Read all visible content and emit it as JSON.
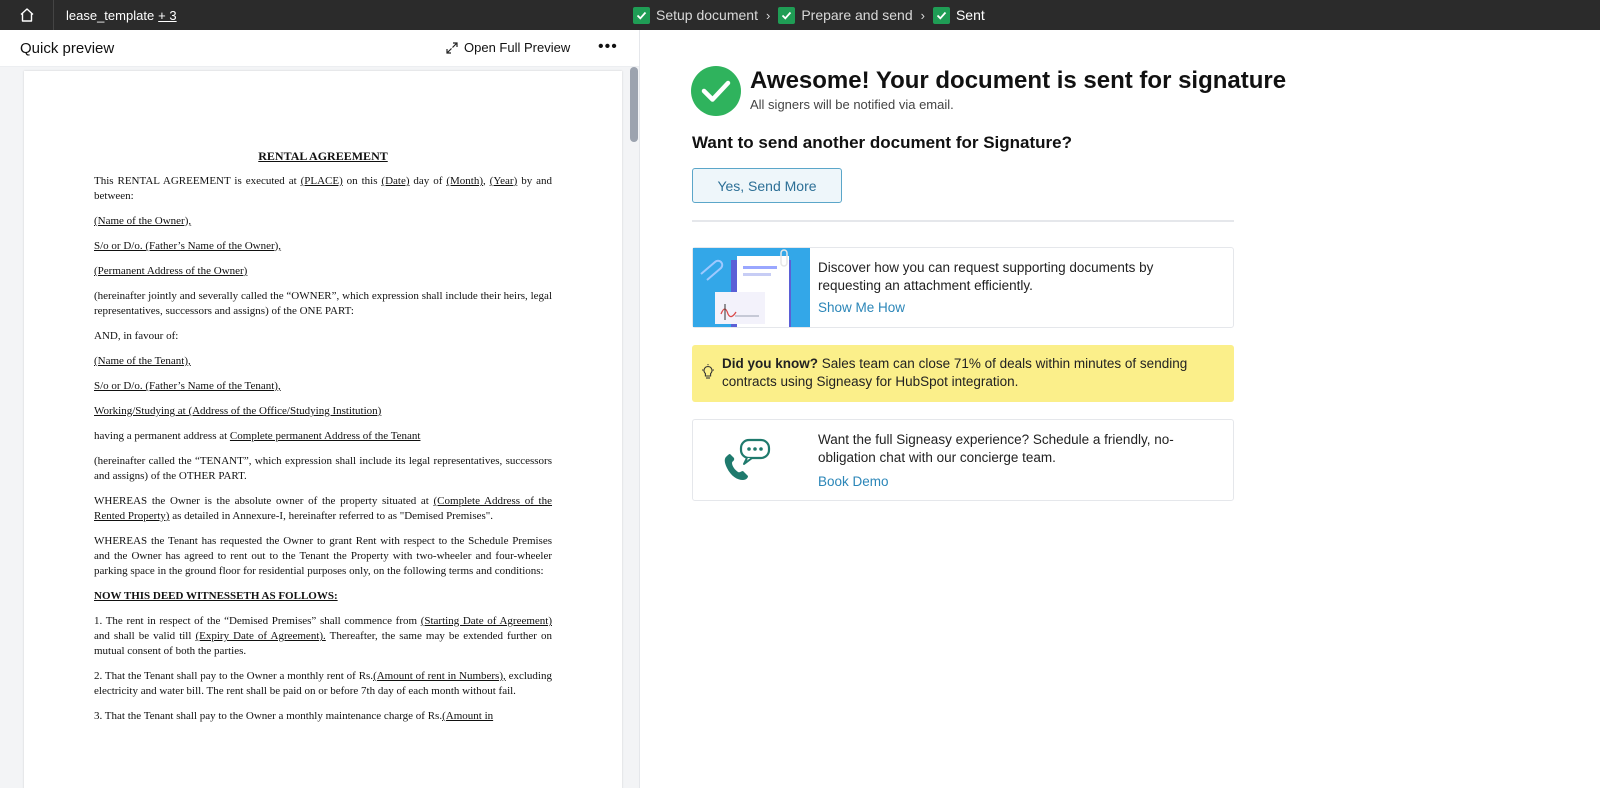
{
  "topbar": {
    "doc_name": "lease_template",
    "doc_count": "+ 3",
    "steps": [
      {
        "label": "Setup document"
      },
      {
        "label": "Prepare and send"
      },
      {
        "label": "Sent"
      }
    ],
    "separator": "›"
  },
  "preview": {
    "title": "Quick preview",
    "open_full": "Open Full Preview",
    "more": "•••"
  },
  "document": {
    "title": "RENTAL AGREEMENT",
    "p1_a": "This RENTAL AGREEMENT is executed at ",
    "p1_place": "(PLACE)",
    "p1_b": " on this ",
    "p1_date": "(Date)",
    "p1_c": " day of ",
    "p1_month": "(Month)",
    "p1_d": ", ",
    "p1_year": "(Year)",
    "p1_e": " by and between:",
    "owner_name": "(Name of the Owner),",
    "owner_father": "S/o or D/o. (Father’s Name of the Owner),",
    "owner_address": "(Permanent Address of the Owner)",
    "owner_clause": "(hereinafter jointly and severally called the “OWNER”, which expression shall include their heirs, legal representatives, successors and assigns) of the ONE PART:",
    "and_favour": "AND, in favour of:",
    "tenant_name": "(Name of the Tenant),",
    "tenant_father": "S/o or D/o. (Father’s Name of the Tenant),",
    "tenant_work": "Working/Studying at (Address of the Office/Studying Institution)",
    "tenant_perm_a": "having a permanent address at ",
    "tenant_perm_b": "Complete permanent Address of the Tenant",
    "tenant_clause": "(hereinafter called the “TENANT”, which expression shall include its legal representatives, successors and assigns) of the OTHER PART.",
    "whereas1_a": "WHEREAS the Owner is the absolute owner of the property situated at ",
    "whereas1_b": "(Complete Address of the Rented Property)",
    "whereas1_c": " as detailed in Annexure-I, hereinafter referred to as \"Demised Premises\".",
    "whereas2": "WHEREAS the Tenant has requested the Owner to grant Rent with respect to the Schedule Premises and the Owner has agreed to rent out to the Tenant the Property with two-wheeler and four-wheeler parking space in the ground floor for residential purposes only, on the following terms and conditions:",
    "witnesseth": "NOW THIS DEED WITNESSETH AS FOLLOWS:",
    "c1_a": "1. The rent in respect of the “Demised Premises” shall commence from ",
    "c1_b": "(Starting Date of Agreement)",
    "c1_c": " and shall be valid till ",
    "c1_d": "(Expiry Date of Agreement).",
    "c1_e": " Thereafter, the same may be extended further on mutual consent of both the parties.",
    "c2_a": "2. That the Tenant shall pay to the Owner a monthly rent of Rs.",
    "c2_b": "(Amount of rent in Numbers),",
    "c2_c": " excluding electricity and water bill. The rent shall be paid on or before 7th day of each month without fail.",
    "c3_a": "3. That the Tenant shall pay to the Owner a monthly maintenance charge of Rs.",
    "c3_b": "(Amount in"
  },
  "success": {
    "title": "Awesome! Your document is sent for signature",
    "subtitle": "All signers will be notified via email.",
    "question": "Want to send another document for Signature?",
    "send_more": "Yes, Send More"
  },
  "card_attachment": {
    "text": "Discover how you can request supporting documents by requesting an attachment efficiently.",
    "link": "Show Me How"
  },
  "tip": {
    "bold": "Did you know?",
    "text": "Sales team can close 71% of deals within minutes of sending contracts using Signeasy for HubSpot integration."
  },
  "card_demo": {
    "text": "Want the full Signeasy experience? Schedule a friendly, no-obligation chat with our concierge team.",
    "link": "Book Demo"
  },
  "colors": {
    "topbar": "#2b2b2b",
    "check_green": "#1f9d55",
    "success_green": "#2fb35d",
    "link_blue": "#2b86b8",
    "tip_yellow": "#fbef8a",
    "card_blue": "#33a7e8",
    "phone_teal": "#1f7a6d"
  }
}
